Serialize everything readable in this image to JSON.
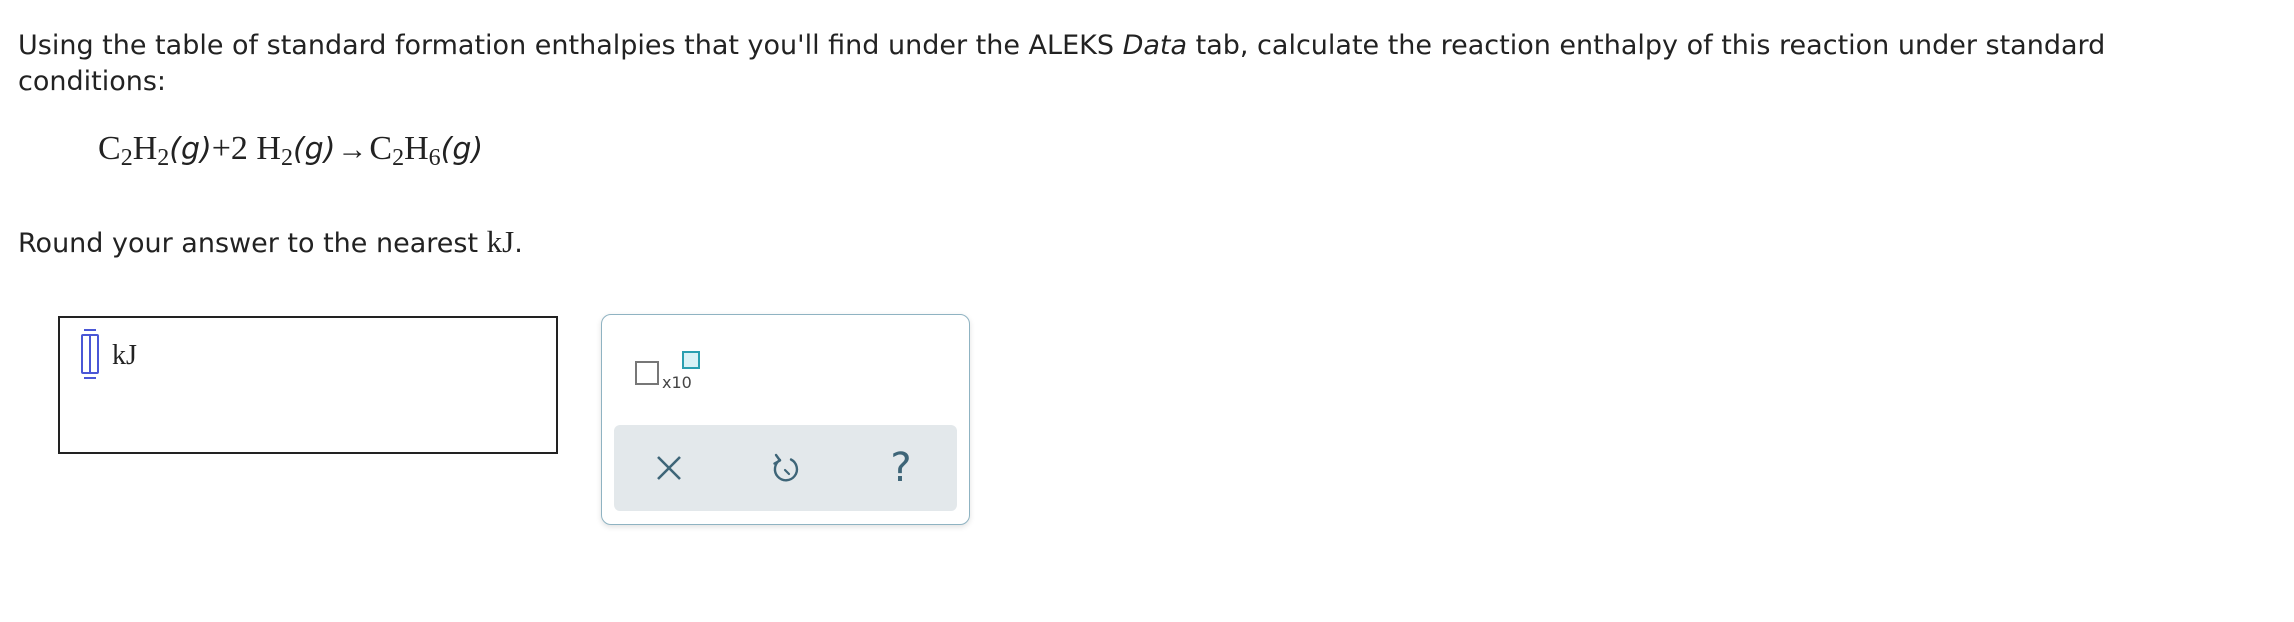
{
  "prompt": {
    "text_before": "Using the table of standard formation enthalpies that you'll find under the ALEKS ",
    "text_italic": "Data",
    "text_after": " tab, calculate the reaction enthalpy of this reaction under standard conditions:"
  },
  "equation": {
    "r1_el1": "C",
    "r1_sub1": "2",
    "r1_el2": "H",
    "r1_sub2": "2",
    "r1_state": "(g)",
    "plus": "+",
    "r2_coef": "2",
    "r2_el1": "H",
    "r2_sub1": "2",
    "r2_state": "(g)",
    "arrow": "→",
    "p_el1": "C",
    "p_sub1": "2",
    "p_el2": "H",
    "p_sub2": "6",
    "p_state": "(g)"
  },
  "instruction": {
    "text": "Round your answer to the nearest ",
    "unit": "kJ",
    "period": "."
  },
  "answer": {
    "value": "",
    "unit": "kJ"
  },
  "tools": {
    "sci_notation_label": "x10",
    "clear_icon": "close-icon",
    "undo_icon": "undo-icon",
    "help_label": "?",
    "accent_color": "#2a9fb0",
    "icon_color": "#3e6578"
  }
}
